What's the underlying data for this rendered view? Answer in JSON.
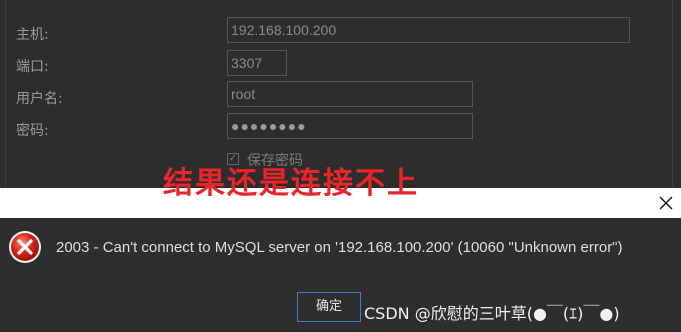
{
  "form": {
    "host_label": "主机:",
    "host_value": "192.168.100.200",
    "port_label": "端口:",
    "port_value": "3307",
    "user_label": "用户名:",
    "user_value": "root",
    "password_label": "密码:",
    "password_value": "●●●●●●●●",
    "save_password_label": "保存密码",
    "save_password_checked": true
  },
  "annotation": {
    "text": "结果还是连接不上",
    "color": "#e8252a"
  },
  "dialog": {
    "close_icon": "close-icon",
    "error_icon": "error-icon",
    "message": "2003 - Can't connect to MySQL server on '192.168.100.200' (10060 \"Unknown error\")",
    "ok_label": "确定",
    "accent_color": "#3f7fc5"
  },
  "watermark": {
    "text": "CSDN @欣慰的三叶草(●￣(ｴ)￣●)"
  }
}
